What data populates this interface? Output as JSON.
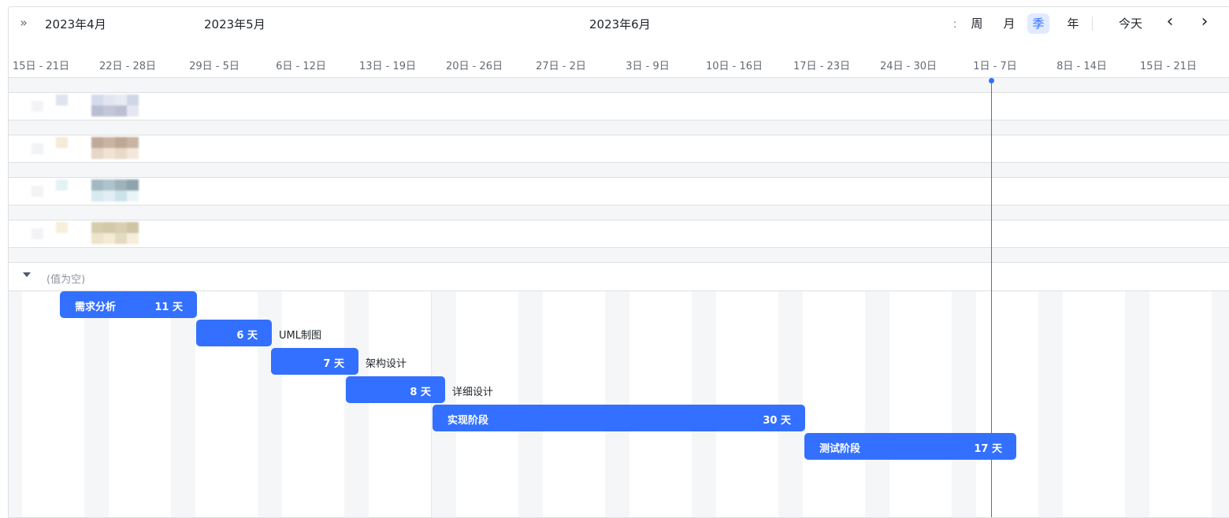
{
  "header": {
    "months": [
      "2023年4月",
      "2023年5月",
      "2023年6月"
    ],
    "weeks": [
      "15日 - 21日",
      "22日 - 28日",
      "29日 - 5日",
      "6日 - 12日",
      "13日 - 19日",
      "20日 - 26日",
      "27日 - 2日",
      "3日 - 9日",
      "10日 - 16日",
      "17日 - 23日",
      "24日 - 30日",
      "1日 - 7日",
      "8日 - 14日",
      "15日 - 21日"
    ]
  },
  "view_controls": {
    "truncated": ":",
    "week": "周",
    "month": "月",
    "quarter": "季",
    "year": "年",
    "today": "今天",
    "prev": "‹",
    "next": "›",
    "active": "quarter"
  },
  "groups": [
    {
      "colors": [
        "#f2f3f5",
        "#dfe3ee",
        "#d6dbea",
        "#e2e5f0",
        "#e8ebf3",
        "#d1d6e6",
        "#b9bed2",
        "#c2c6d8",
        "#bcbfd1",
        "#e4e7f2"
      ]
    },
    {
      "colors": [
        "#f2f3f5",
        "#f6ead9",
        "#bfa99a",
        "#cbb3a1",
        "#bda795",
        "#c9b4a2",
        "#e5d6c6",
        "#f1e3d1",
        "#ead9c6",
        "#f3e8db"
      ]
    },
    {
      "colors": [
        "#f2f3f5",
        "#e4f2f6",
        "#a3b8c2",
        "#aec3cc",
        "#9fb1bb",
        "#8ea3ad",
        "#d6eaf0",
        "#e1eff4",
        "#cde3ea",
        "#e9f4f7"
      ]
    },
    {
      "colors": [
        "#f2f3f5",
        "#f6efd9",
        "#d6cdaf",
        "#d3c8a8",
        "#d9cfb0",
        "#cfc4a5",
        "#ede4c9",
        "#f3ebd4",
        "#e4dac0",
        "#f5eed9"
      ]
    }
  ],
  "empty_group": {
    "label": "(值为空)"
  },
  "tasks": [
    {
      "name": "需求分析",
      "duration": "11 天"
    },
    {
      "name": "UML制图",
      "duration": "6 天"
    },
    {
      "name": "架构设计",
      "duration": "7 天"
    },
    {
      "name": "详细设计",
      "duration": "8 天"
    },
    {
      "name": "实现阶段",
      "duration": "30 天"
    },
    {
      "name": "测试阶段",
      "duration": "17 天"
    }
  ],
  "colors": {
    "accent": "#3370ff",
    "weekend": "#f5f6f7"
  }
}
